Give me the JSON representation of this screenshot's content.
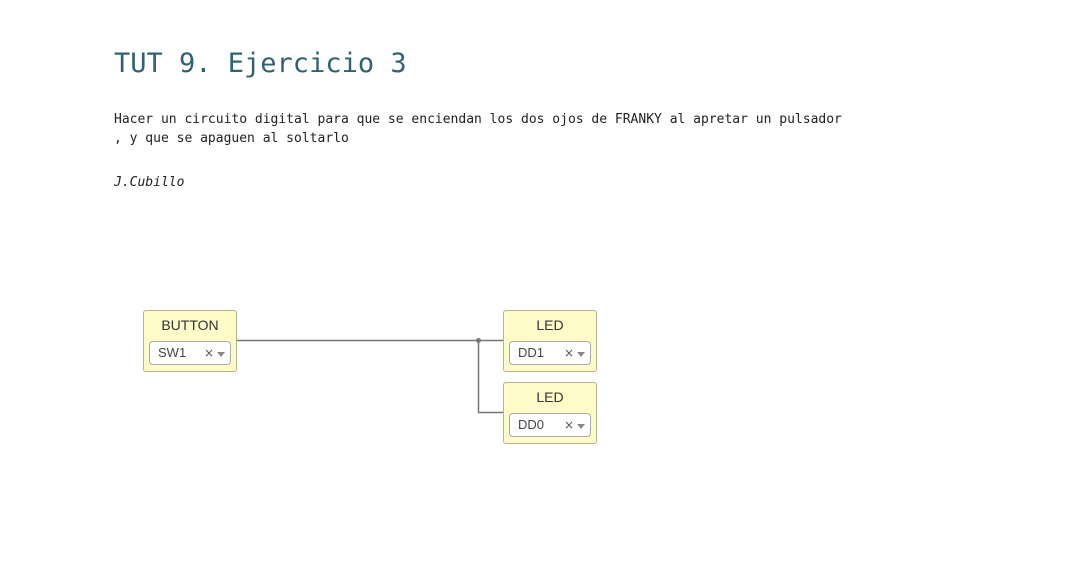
{
  "page": {
    "title": "TUT 9. Ejercicio 3",
    "description_lines": [
      "Hacer un circuito digital para que se enciendan los dos ojos de FRANKY al apretar un pulsador",
      ", y que se apaguen al soltarlo"
    ],
    "author": "J.Cubillo"
  },
  "diagram": {
    "blocks": [
      {
        "type": "BUTTON",
        "value": "SW1",
        "clear_icon": "×",
        "dropdown_icon": "caret-down"
      },
      {
        "type": "LED",
        "value": "DD1",
        "clear_icon": "×",
        "dropdown_icon": "caret-down"
      },
      {
        "type": "LED",
        "value": "DD0",
        "clear_icon": "×",
        "dropdown_icon": "caret-down"
      }
    ],
    "wires": [
      {
        "from": "BUTTON",
        "to": "LED",
        "to_value": "DD1"
      },
      {
        "from": "BUTTON",
        "to": "LED",
        "to_value": "DD0"
      }
    ],
    "colors": {
      "title": "#2f6373",
      "block_fill": "#fefbc9",
      "block_border": "#b8b48a",
      "wire": "#777777"
    }
  }
}
